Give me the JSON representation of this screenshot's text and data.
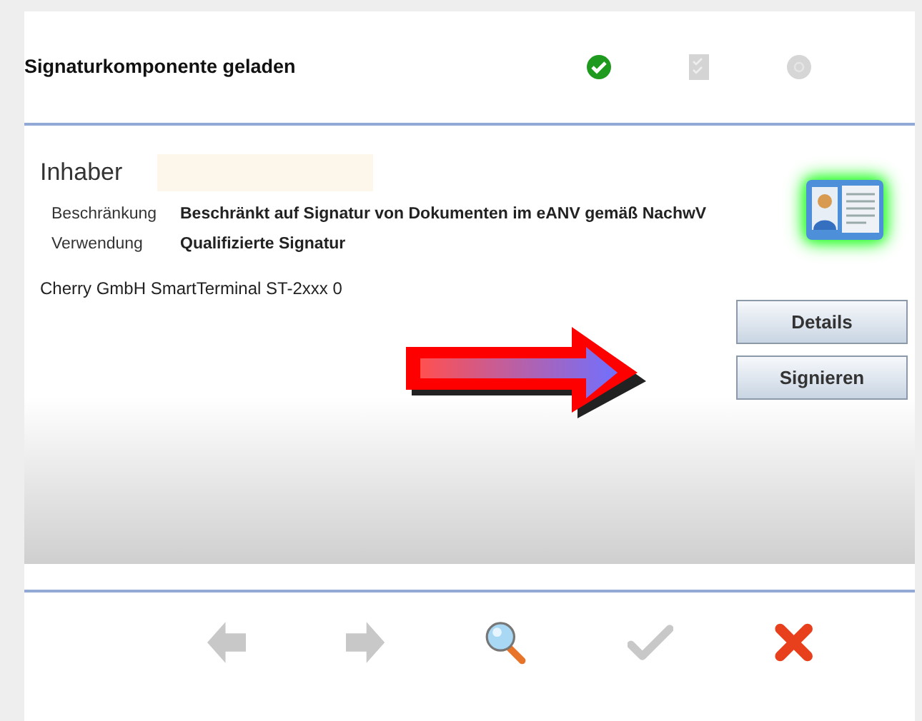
{
  "header": {
    "title": "Signaturkomponente geladen",
    "steps": [
      {
        "kind": "check",
        "done": true
      },
      {
        "kind": "list",
        "done": false
      },
      {
        "kind": "help",
        "done": false
      }
    ]
  },
  "holder": {
    "label": "Inhaber"
  },
  "properties": [
    {
      "label": "Beschränkung",
      "value": "Beschränkt auf Signatur von Dokumenten im eANV gemäß NachwV"
    },
    {
      "label": "Verwendung",
      "value": "Qualifizierte Signatur"
    }
  ],
  "reader": "Cherry GmbH SmartTerminal ST-2xxx 0",
  "card": {
    "active": true
  },
  "buttons": [
    "Details",
    "Signieren"
  ],
  "toolbar": [
    {
      "kind": "back",
      "disabled": true
    },
    {
      "kind": "forward",
      "disabled": true
    },
    {
      "kind": "search",
      "disabled": false
    },
    {
      "kind": "confirm",
      "disabled": true
    },
    {
      "kind": "cancel",
      "disabled": false
    }
  ]
}
